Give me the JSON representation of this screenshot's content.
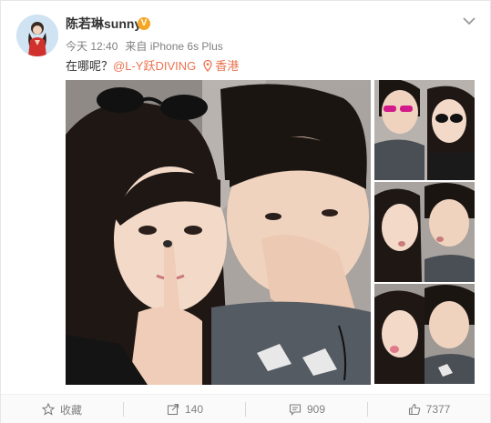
{
  "post": {
    "username": "陈若琳sunny",
    "verified_badge": "V",
    "time": "今天 12:40",
    "source": "来自 iPhone 6s Plus",
    "text_prefix": "在哪呢？",
    "mention": "@L-Y跃DIVING",
    "location": "香港"
  },
  "actions": {
    "favorite": "收藏",
    "repost": "140",
    "comment": "909",
    "like": "7377"
  },
  "icons": {
    "menu": "chevron-down-icon",
    "location": "map-pin-icon",
    "favorite": "star-icon",
    "repost": "share-icon",
    "comment": "comment-icon",
    "like": "thumbs-up-icon"
  },
  "colors": {
    "link": "#eb7350",
    "text": "#333333",
    "meta": "#808080",
    "badge": "#f5a623"
  }
}
